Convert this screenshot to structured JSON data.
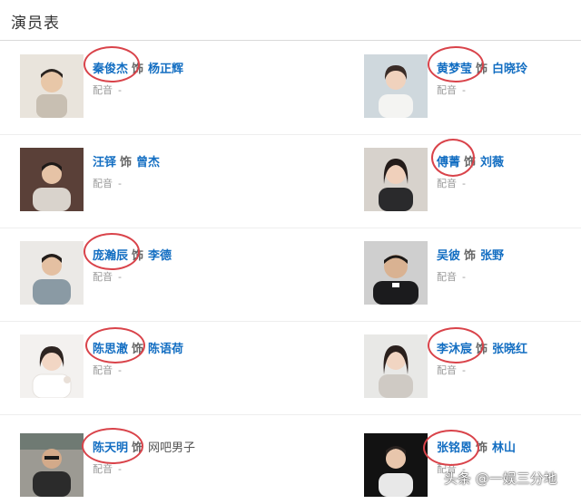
{
  "header": {
    "title": "演员表"
  },
  "cast": [
    {
      "actor": "秦俊杰",
      "sep": "饰",
      "character": "杨正辉",
      "voice_label": "配音",
      "voice_value": "-",
      "highlighted": true
    },
    {
      "actor": "黄梦莹",
      "sep": "饰",
      "character": "白晓玲",
      "voice_label": "配音",
      "voice_value": "-",
      "highlighted": true
    },
    {
      "actor": "汪铎",
      "sep": "饰",
      "character": "曾杰",
      "voice_label": "配音",
      "voice_value": "-",
      "highlighted": false
    },
    {
      "actor": "傅菁",
      "sep": "饰",
      "character": "刘薇",
      "voice_label": "配音",
      "voice_value": "-",
      "highlighted": true
    },
    {
      "actor": "庞瀚辰",
      "sep": "饰",
      "character": "李德",
      "voice_label": "配音",
      "voice_value": "-",
      "highlighted": true
    },
    {
      "actor": "吴彼",
      "sep": "饰",
      "character": "张野",
      "voice_label": "配音",
      "voice_value": "-",
      "highlighted": false
    },
    {
      "actor": "陈思澈",
      "sep": "饰",
      "character": "陈语荷",
      "voice_label": "配音",
      "voice_value": "-",
      "highlighted": true
    },
    {
      "actor": "李沐宸",
      "sep": "饰",
      "character": "张晓红",
      "voice_label": "配音",
      "voice_value": "-",
      "highlighted": true
    },
    {
      "actor": "陈天明",
      "sep": "饰",
      "character": "网吧男子",
      "voice_label": "配音",
      "voice_value": "-",
      "highlighted": true
    },
    {
      "actor": "张铭恩",
      "sep": "饰",
      "character": "林山",
      "voice_label": "配音",
      "voice_value": "-",
      "highlighted": true
    }
  ],
  "watermark": "头条 @一娱三分地",
  "colors": {
    "link": "#136ec2",
    "circle": "#d9434a",
    "muted": "#9a9a9a"
  }
}
